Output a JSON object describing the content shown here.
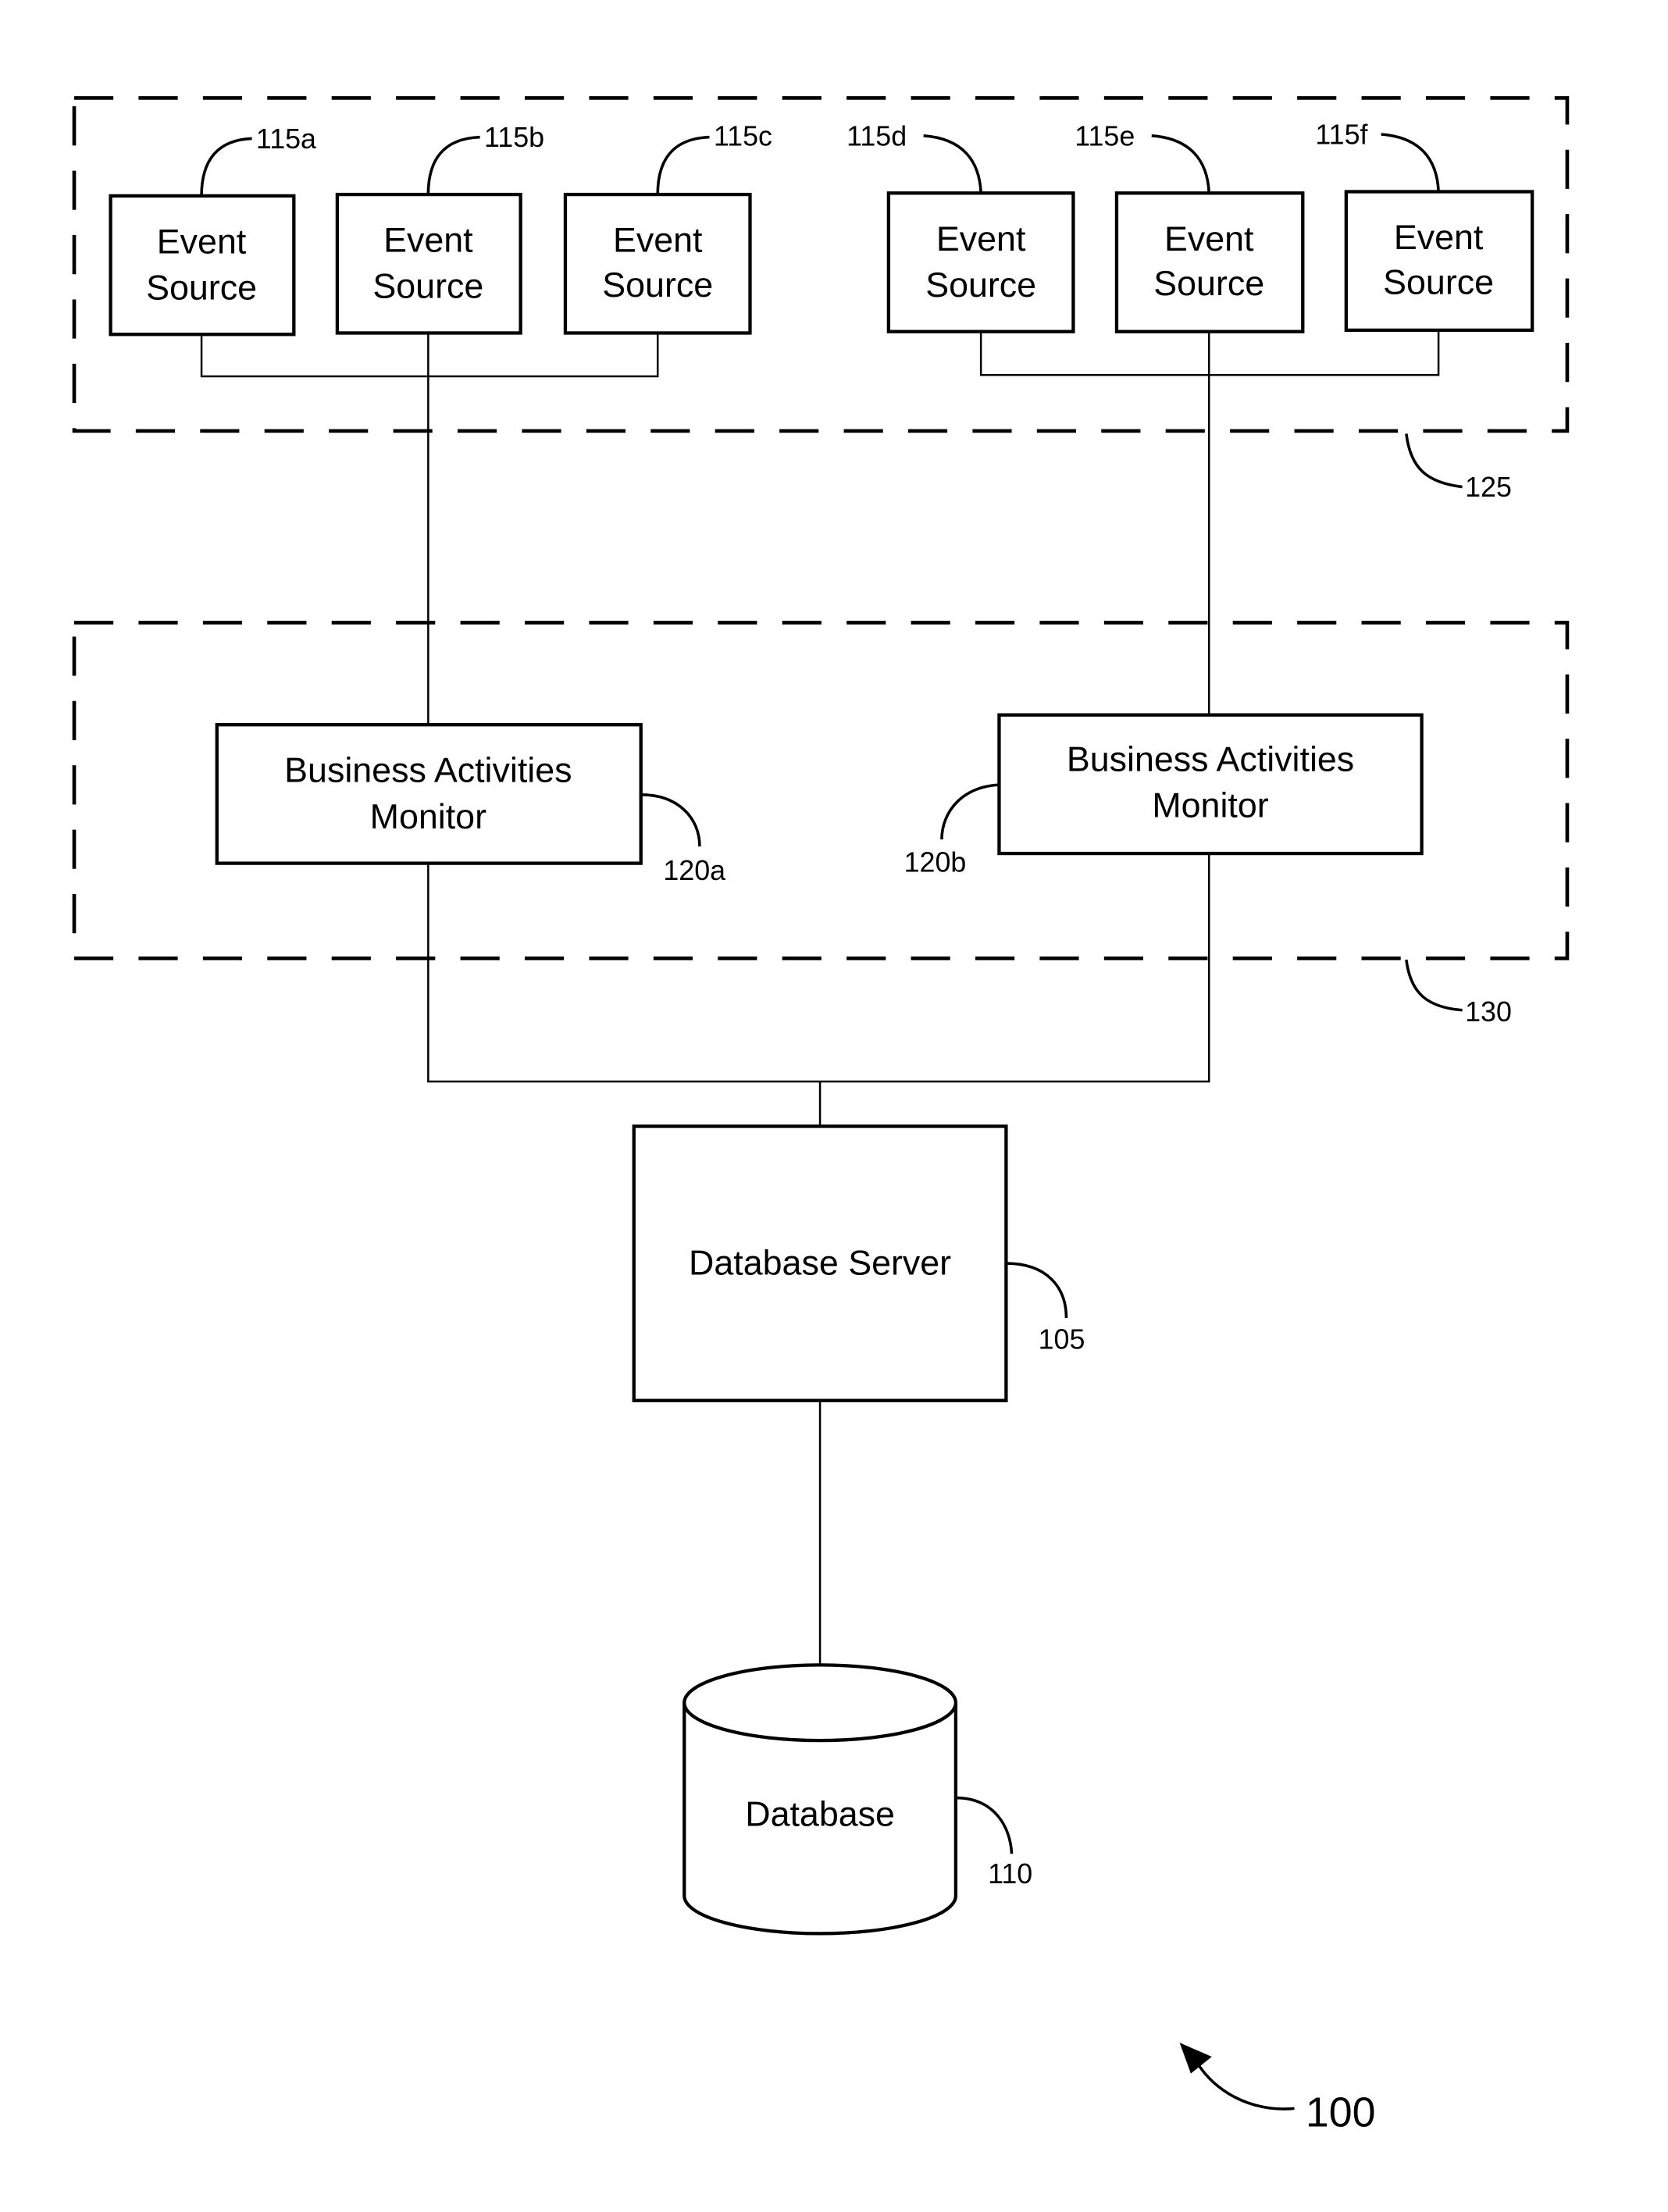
{
  "figure": {
    "number": "100",
    "groups": [
      {
        "id": "125",
        "ref": "125"
      },
      {
        "id": "130",
        "ref": "130"
      }
    ],
    "event_sources": [
      {
        "line1": "Event",
        "line2": "Source",
        "ref": "115a"
      },
      {
        "line1": "Event",
        "line2": "Source",
        "ref": "115b"
      },
      {
        "line1": "Event",
        "line2": "Source",
        "ref": "115c"
      },
      {
        "line1": "Event",
        "line2": "Source",
        "ref": "115d"
      },
      {
        "line1": "Event",
        "line2": "Source",
        "ref": "115e"
      },
      {
        "line1": "Event",
        "line2": "Source",
        "ref": "115f"
      }
    ],
    "monitors": [
      {
        "line1": "Business Activities",
        "line2": "Monitor",
        "ref": "120a"
      },
      {
        "line1": "Business Activities",
        "line2": "Monitor",
        "ref": "120b"
      }
    ],
    "database_server": {
      "label": "Database Server",
      "ref": "105"
    },
    "database": {
      "label": "Database",
      "ref": "110"
    }
  }
}
